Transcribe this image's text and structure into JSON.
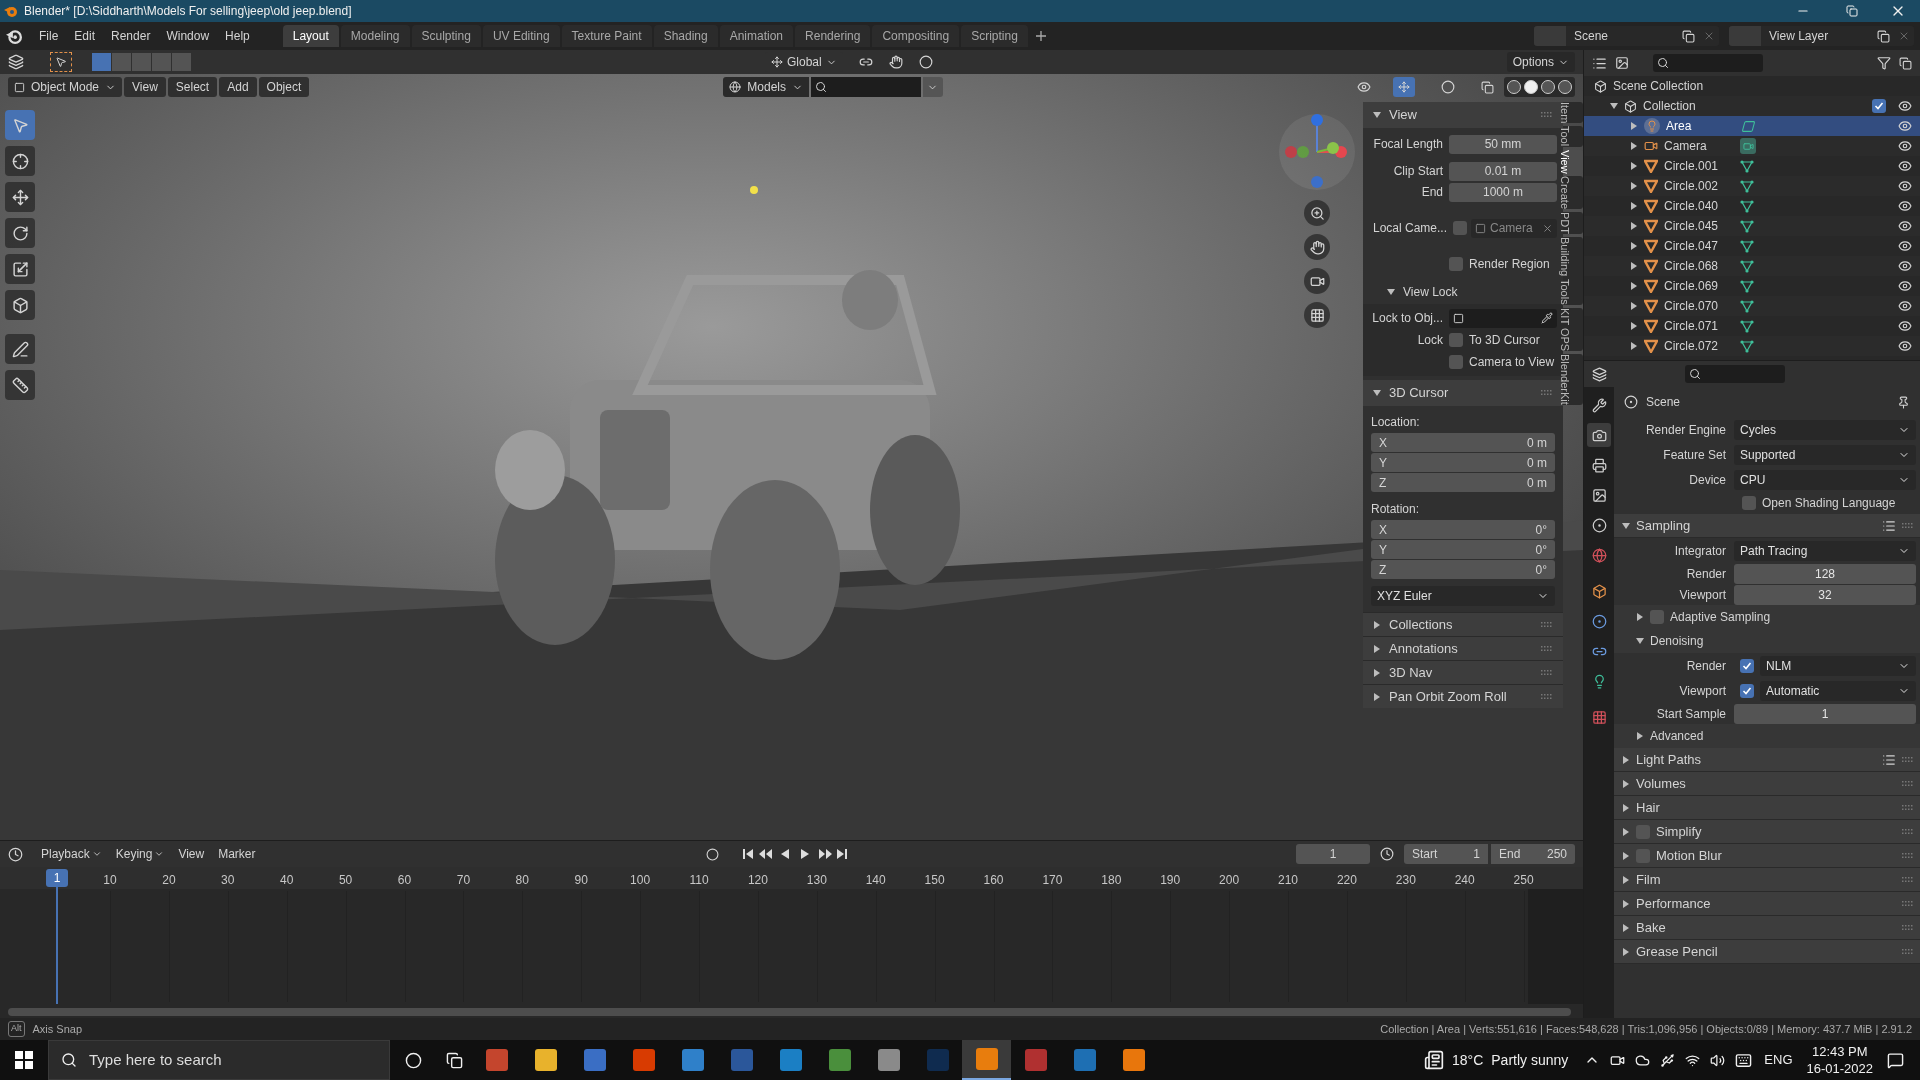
{
  "window": {
    "title": "Blender* [D:\\Siddharth\\Models For selling\\jeep\\old jeep.blend]"
  },
  "menu": [
    "File",
    "Edit",
    "Render",
    "Window",
    "Help"
  ],
  "workspaces": [
    {
      "label": "Layout",
      "selected": true
    },
    {
      "label": "Modeling",
      "selected": false
    },
    {
      "label": "Sculpting",
      "selected": false
    },
    {
      "label": "UV Editing",
      "selected": false
    },
    {
      "label": "Texture Paint",
      "selected": false
    },
    {
      "label": "Shading",
      "selected": false
    },
    {
      "label": "Animation",
      "selected": false
    },
    {
      "label": "Rendering",
      "selected": false
    },
    {
      "label": "Compositing",
      "selected": false
    },
    {
      "label": "Scripting",
      "selected": false
    }
  ],
  "scene": {
    "name": "Scene",
    "view_layer": "View Layer"
  },
  "viewport": {
    "orientation": "Global",
    "options": "Options",
    "mode": "Object Mode",
    "menus": [
      "View",
      "Select",
      "Add",
      "Object"
    ],
    "collection": "Models"
  },
  "n_panel": {
    "tabs": [
      {
        "label": "Item",
        "selected": false
      },
      {
        "label": "Tool",
        "selected": false
      },
      {
        "label": "View",
        "selected": true
      },
      {
        "label": "Create",
        "selected": false
      },
      {
        "label": "PDT",
        "selected": false
      },
      {
        "label": "Building Tools",
        "selected": false
      },
      {
        "label": "KIT OPS",
        "selected": false
      },
      {
        "label": "BlenderKit",
        "selected": false
      }
    ],
    "view": {
      "title": "View",
      "fields": [
        {
          "label": "Focal Length",
          "value": "50 mm"
        },
        {
          "label": "Clip Start",
          "value": "0.01 m"
        },
        {
          "label": "End",
          "value": "1000 m"
        }
      ],
      "local_camera": {
        "label": "Local Came...",
        "checked": false,
        "placeholder": "Camera"
      },
      "render_region": {
        "label": "Render Region",
        "checked": false
      }
    },
    "view_lock": {
      "title": "View Lock",
      "lock_to": "Lock to Obj...",
      "lock": "Lock",
      "options": [
        {
          "label": "To 3D Cursor",
          "checked": false
        },
        {
          "label": "Camera to View",
          "checked": false
        }
      ]
    },
    "cursor": {
      "title": "3D Cursor",
      "location_label": "Location:",
      "location": [
        {
          "axis": "X",
          "value": "0 m"
        },
        {
          "axis": "Y",
          "value": "0 m"
        },
        {
          "axis": "Z",
          "value": "0 m"
        }
      ],
      "rotation_label": "Rotation:",
      "rotation": [
        {
          "axis": "X",
          "value": "0°"
        },
        {
          "axis": "Y",
          "value": "0°"
        },
        {
          "axis": "Z",
          "value": "0°"
        }
      ],
      "rotation_mode": "XYZ Euler"
    },
    "collapsed": [
      "Collections",
      "Annotations",
      "3D Nav",
      "Pan Orbit Zoom Roll"
    ]
  },
  "outliner": {
    "root": "Scene Collection",
    "collection": {
      "name": "Collection",
      "checked": true
    },
    "items": [
      {
        "name": "Area",
        "kind": "light",
        "selected": true
      },
      {
        "name": "Camera",
        "kind": "camera",
        "selected": false
      },
      {
        "name": "Circle.001",
        "kind": "mesh",
        "selected": false
      },
      {
        "name": "Circle.002",
        "kind": "mesh",
        "selected": false
      },
      {
        "name": "Circle.040",
        "kind": "mesh",
        "selected": false
      },
      {
        "name": "Circle.045",
        "kind": "mesh",
        "selected": false
      },
      {
        "name": "Circle.047",
        "kind": "mesh",
        "selected": false
      },
      {
        "name": "Circle.068",
        "kind": "mesh",
        "selected": false
      },
      {
        "name": "Circle.069",
        "kind": "mesh",
        "selected": false
      },
      {
        "name": "Circle.070",
        "kind": "mesh",
        "selected": false
      },
      {
        "name": "Circle.071",
        "kind": "mesh",
        "selected": false
      },
      {
        "name": "Circle.072",
        "kind": "mesh",
        "selected": false
      }
    ]
  },
  "properties": {
    "context": "Scene",
    "rows": [
      {
        "kind": "dropdown",
        "label": "Render Engine",
        "value": "Cycles"
      },
      {
        "kind": "dropdown",
        "label": "Feature Set",
        "value": "Supported"
      },
      {
        "kind": "dropdown",
        "label": "Device",
        "value": "CPU"
      },
      {
        "kind": "checkbox",
        "label": "Open Shading Language",
        "checked": false
      },
      {
        "kind": "section",
        "label": "Sampling",
        "expanded": true,
        "presets": true
      },
      {
        "kind": "dropdown",
        "label": "Integrator",
        "value": "Path Tracing"
      },
      {
        "kind": "number",
        "label": "Render",
        "value": "128"
      },
      {
        "kind": "number",
        "label": "Viewport",
        "value": "32"
      },
      {
        "kind": "subsection",
        "label": "Adaptive Sampling",
        "expanded": false,
        "checked": false
      },
      {
        "kind": "subsection",
        "label": "Denoising",
        "expanded": true
      },
      {
        "kind": "check_dropdown",
        "label": "Render",
        "checked": true,
        "value": "NLM"
      },
      {
        "kind": "check_dropdown",
        "label": "Viewport",
        "checked": true,
        "value": "Automatic"
      },
      {
        "kind": "number",
        "label": "Start Sample",
        "value": "1"
      },
      {
        "kind": "subsection",
        "label": "Advanced",
        "expanded": false
      },
      {
        "kind": "section",
        "label": "Light Paths",
        "expanded": false,
        "presets": true
      },
      {
        "kind": "section",
        "label": "Volumes",
        "expanded": false
      },
      {
        "kind": "section",
        "label": "Hair",
        "expanded": false
      },
      {
        "kind": "section",
        "label": "Simplify",
        "expanded": false,
        "checked": false
      },
      {
        "kind": "section",
        "label": "Motion Blur",
        "expanded": false,
        "checked": false
      },
      {
        "kind": "section",
        "label": "Film",
        "expanded": false
      },
      {
        "kind": "section",
        "label": "Performance",
        "expanded": false
      },
      {
        "kind": "section",
        "label": "Bake",
        "expanded": false
      },
      {
        "kind": "section",
        "label": "Grease Pencil",
        "expanded": false
      }
    ]
  },
  "timeline": {
    "menus": [
      "Playback",
      "Keying",
      "View",
      "Marker"
    ],
    "current_frame": "1",
    "start_label": "Start",
    "start": "1",
    "end_label": "End",
    "end": "250",
    "playhead": "1",
    "ticks": [
      "10",
      "20",
      "30",
      "40",
      "50",
      "60",
      "70",
      "80",
      "90",
      "100",
      "110",
      "120",
      "130",
      "140",
      "150",
      "160",
      "170",
      "180",
      "190",
      "200",
      "210",
      "220",
      "230",
      "240",
      "250"
    ]
  },
  "status_bar": {
    "key": "Alt",
    "hint": "Axis Snap",
    "stats": "Collection | Area | Verts:551,616 | Faces:548,628 | Tris:1,096,956 | Objects:0/89 | Memory: 437.7 MiB | 2.91.2"
  },
  "taskbar": {
    "search_placeholder": "Type here to search",
    "temperature": "18°C",
    "weather": "Partly sunny",
    "language": "ENG",
    "time": "12:43 PM",
    "date": "16-01-2022"
  }
}
